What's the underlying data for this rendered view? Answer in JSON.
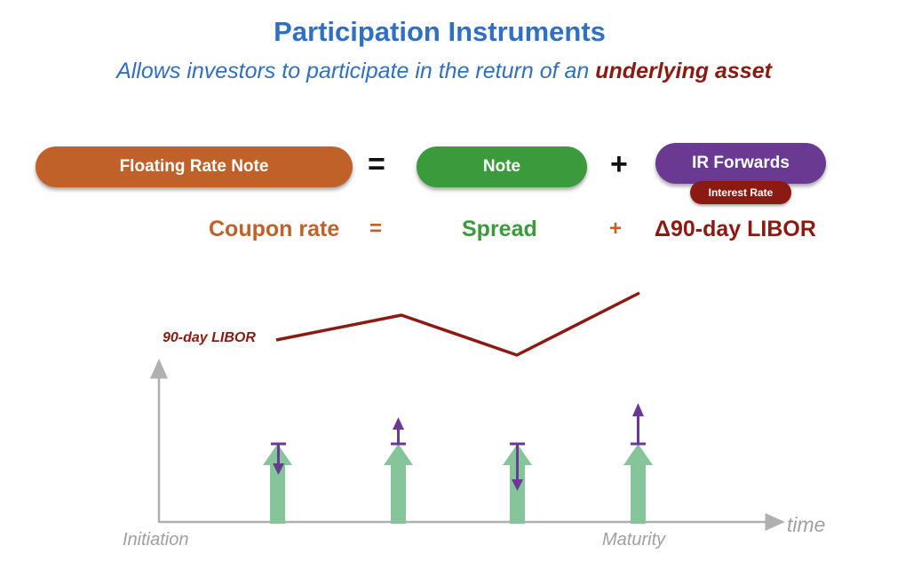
{
  "header": {
    "title": "Participation Instruments",
    "subtitle_prefix": "Allows investors to participate in the return of an ",
    "subtitle_highlight": "underlying asset"
  },
  "equation": {
    "floating_rate_note": "Floating Rate Note",
    "equals": "=",
    "note": "Note",
    "plus": "+",
    "ir_forwards": "IR Forwards",
    "interest_rate": "Interest Rate"
  },
  "rates": {
    "coupon_rate": "Coupon rate",
    "equals": "=",
    "spread": "Spread",
    "plus": "+",
    "libor_change": "Δ90-day LIBOR"
  },
  "chart": {
    "libor_label": "90-day LIBOR",
    "x_start_label": "Initiation",
    "x_end_label": "Maturity",
    "x_axis_label": "time"
  },
  "colors": {
    "title_blue": "#2f6fc4",
    "frn_orange": "#c0612a",
    "note_green": "#3a9a3c",
    "forward_purple": "#6a3a93",
    "libor_red": "#8b1a12",
    "spread_bar_green": "#86c49a"
  }
}
